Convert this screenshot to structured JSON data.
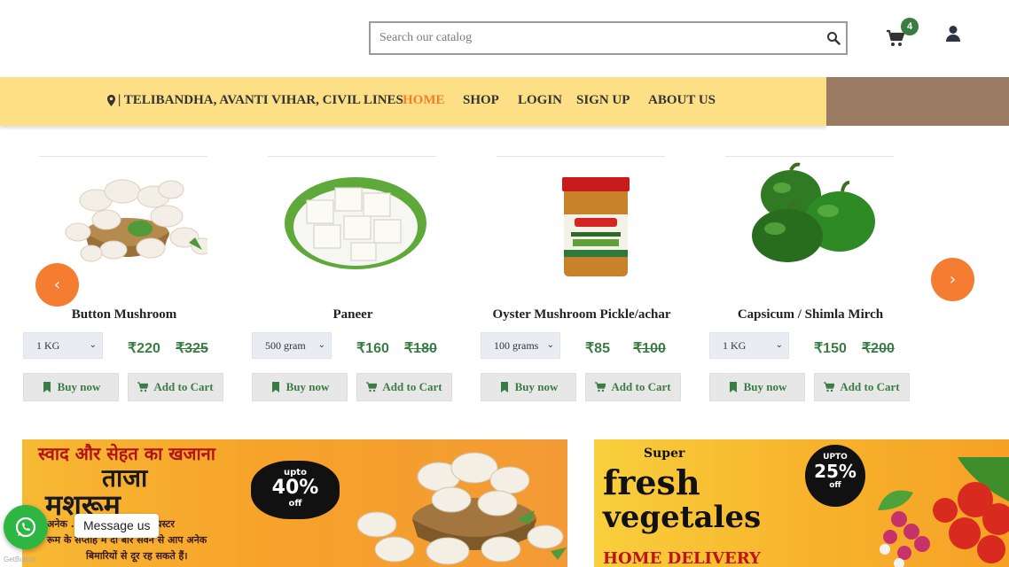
{
  "search": {
    "placeholder": "Search our catalog",
    "icon": "search-icon"
  },
  "cart": {
    "icon": "cart-icon",
    "count": "4",
    "badge_color": "#3a7d44"
  },
  "user": {
    "icon": "user-icon"
  },
  "nav": {
    "location_icon": "map-marker-icon",
    "location": "| TELIBANDHA, AVANTI VIHAR, CIVIL LINES",
    "links": [
      {
        "label": "HOME",
        "active": true
      },
      {
        "label": "SHOP"
      },
      {
        "label": "LOGIN"
      },
      {
        "label": "SIGN UP"
      },
      {
        "label": "ABOUT US"
      }
    ],
    "bg_color": "#fde086",
    "accent_color": "#f37f2a"
  },
  "products": [
    {
      "name": "Button Mushroom",
      "quantity": "1 KG",
      "price": "₹220",
      "old_price": "₹325",
      "buy_label": "Buy now",
      "cart_label": "Add to Cart"
    },
    {
      "name": "Paneer",
      "quantity": "500 gram",
      "price": "₹160",
      "old_price": "₹180",
      "buy_label": "Buy now",
      "cart_label": "Add to Cart"
    },
    {
      "name": "Oyster Mushroom Pickle/achar",
      "quantity": "100 grams",
      "price": "₹85",
      "old_price": "₹100",
      "buy_label": "Buy now",
      "cart_label": "Add to Cart"
    },
    {
      "name": "Capsicum / Shimla Mirch",
      "quantity": "1 KG",
      "price": "₹150",
      "old_price": "₹200",
      "buy_label": "Buy now",
      "cart_label": "Add to Cart"
    }
  ],
  "carousel": {
    "prev": "‹",
    "next": "›",
    "color": "#f47d32"
  },
  "banners": {
    "mushroom": {
      "tagline": "स्वाद और सेहत का खजाना",
      "title1": "ताजा",
      "title2": "मशरूम",
      "discount_top": "upto",
      "discount_value": "40%",
      "discount_bottom": "off",
      "line1": "अनेक ... से भरपूर बटन व ऑयस्टर",
      "line2": "रूम के सप्ताह में दो बार सेवन से आप अनेक",
      "line3": "बिमारियों से दूर रह सकते हैं।"
    },
    "vegetables": {
      "super": "Super",
      "fresh": "fresh",
      "vegetables": "vegetales",
      "discount_top": "UPTO",
      "discount_value": "25%",
      "discount_bottom": "off",
      "delivery": "HOME DELIVERY"
    }
  },
  "whatsapp": {
    "icon": "whatsapp-icon",
    "label": "Message us",
    "footer": "GetButton"
  }
}
